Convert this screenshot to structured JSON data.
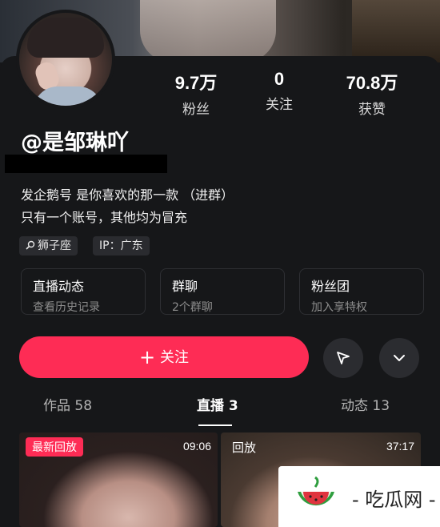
{
  "profile": {
    "username": "@是邹琳吖",
    "bio_lines": [
      "发企鹅号 是你喜欢的那一款  （进群）",
      "只有一个账号，其他均为冒充"
    ]
  },
  "stats": [
    {
      "value": "9.7万",
      "label": "粉丝"
    },
    {
      "value": "0",
      "label": "关注"
    },
    {
      "value": "70.8万",
      "label": "获赞"
    }
  ],
  "tags": [
    {
      "label": "狮子座",
      "icon": "search-icon"
    },
    {
      "label": "IP：广东"
    }
  ],
  "cards": [
    {
      "title": "直播动态",
      "subtitle": "查看历史记录"
    },
    {
      "title": "群聊",
      "subtitle": "2个群聊"
    },
    {
      "title": "粉丝团",
      "subtitle": "加入享特权"
    }
  ],
  "actions": {
    "follow_label": "关注",
    "share_icon": "send-icon",
    "more_icon": "chevron-down-icon"
  },
  "tabs": [
    {
      "label": "作品 58",
      "active": false
    },
    {
      "label": "直播 3",
      "active": true
    },
    {
      "label": "动态 13",
      "active": false
    }
  ],
  "videos": [
    {
      "badge": "最新回放",
      "duration": "09:06"
    },
    {
      "badge": "回放",
      "duration": "37:17"
    }
  ],
  "watermark": {
    "text": "- 吃瓜网 -"
  },
  "colors": {
    "accent": "#fe2c55",
    "background": "#161719"
  }
}
